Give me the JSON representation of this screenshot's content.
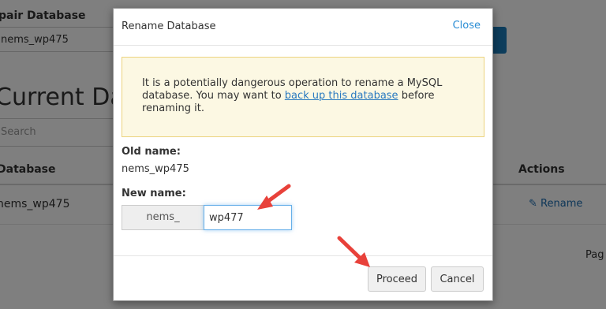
{
  "background": {
    "repair_label": "pair Database",
    "repair_select_value": "nems_wp475",
    "heading": "Current Dat",
    "search_placeholder": "Search",
    "table": {
      "col_database": "Database",
      "col_actions": "Actions",
      "row_database": "nems_wp475",
      "row_action": "Rename"
    },
    "page_text": "Pag"
  },
  "modal": {
    "title": "Rename Database",
    "close_label": "Close",
    "warning": {
      "text_before": "It is a potentially dangerous operation to rename a MySQL database. You may want to ",
      "link_text": "back up this database",
      "text_after": " before renaming it."
    },
    "old_name_label": "Old name:",
    "old_name_value": "nems_wp475",
    "new_name_label": "New name:",
    "new_name_prefix": "nems_",
    "new_name_value": "wp477",
    "proceed_label": "Proceed",
    "cancel_label": "Cancel"
  },
  "annotations": {
    "arrow_color": "#e8413a"
  }
}
